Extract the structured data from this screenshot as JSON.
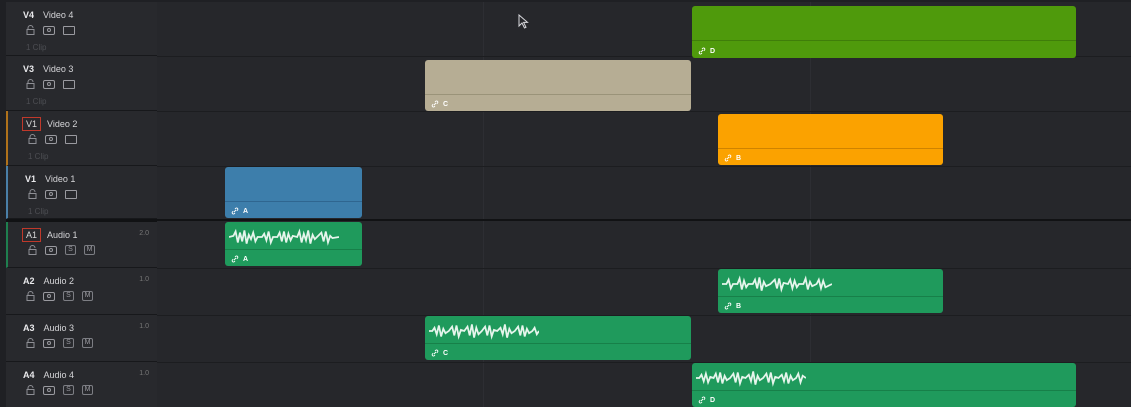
{
  "tracks": {
    "video": [
      {
        "id": "V4",
        "name": "Video 4",
        "clip_count": "1 Clip",
        "selected": false
      },
      {
        "id": "V3",
        "name": "Video 3",
        "clip_count": "1 Clip",
        "selected": false
      },
      {
        "id": "V1",
        "name": "Video 2",
        "clip_count": "1 Clip",
        "selected": true
      },
      {
        "id": "V1",
        "name": "Video 1",
        "clip_count": "1 Clip",
        "selected": false
      }
    ],
    "audio": [
      {
        "id": "A1",
        "name": "Audio 1",
        "channels": "2.0",
        "solo_label": "S",
        "mute_label": "M",
        "selected": true
      },
      {
        "id": "A2",
        "name": "Audio 2",
        "channels": "1.0",
        "solo_label": "S",
        "mute_label": "M",
        "selected": false
      },
      {
        "id": "A3",
        "name": "Audio 3",
        "channels": "1.0",
        "solo_label": "S",
        "mute_label": "M",
        "selected": false
      },
      {
        "id": "A4",
        "name": "Audio 4",
        "channels": "1.0",
        "solo_label": "S",
        "mute_label": "M",
        "selected": false
      }
    ]
  },
  "clips": {
    "video": [
      {
        "track": "Video 4",
        "label": "D",
        "color": "#4f9a0c"
      },
      {
        "track": "Video 3",
        "label": "C",
        "color": "#b6ad94"
      },
      {
        "track": "Video 2",
        "label": "B",
        "color": "#fba200"
      },
      {
        "track": "Video 1",
        "label": "A",
        "color": "#3d7eab"
      }
    ],
    "audio": [
      {
        "track": "Audio 1",
        "label": "A",
        "color": "#1f9a5c"
      },
      {
        "track": "Audio 2",
        "label": "B",
        "color": "#1f9a5c"
      },
      {
        "track": "Audio 3",
        "label": "C",
        "color": "#1f9a5c"
      },
      {
        "track": "Audio 4",
        "label": "D",
        "color": "#1f9a5c"
      }
    ]
  },
  "icons": {
    "lock": "lock-icon",
    "eye": "eye-icon",
    "screen": "screen-icon",
    "link": "link-icon",
    "cursor": "mouse-pointer-icon"
  }
}
